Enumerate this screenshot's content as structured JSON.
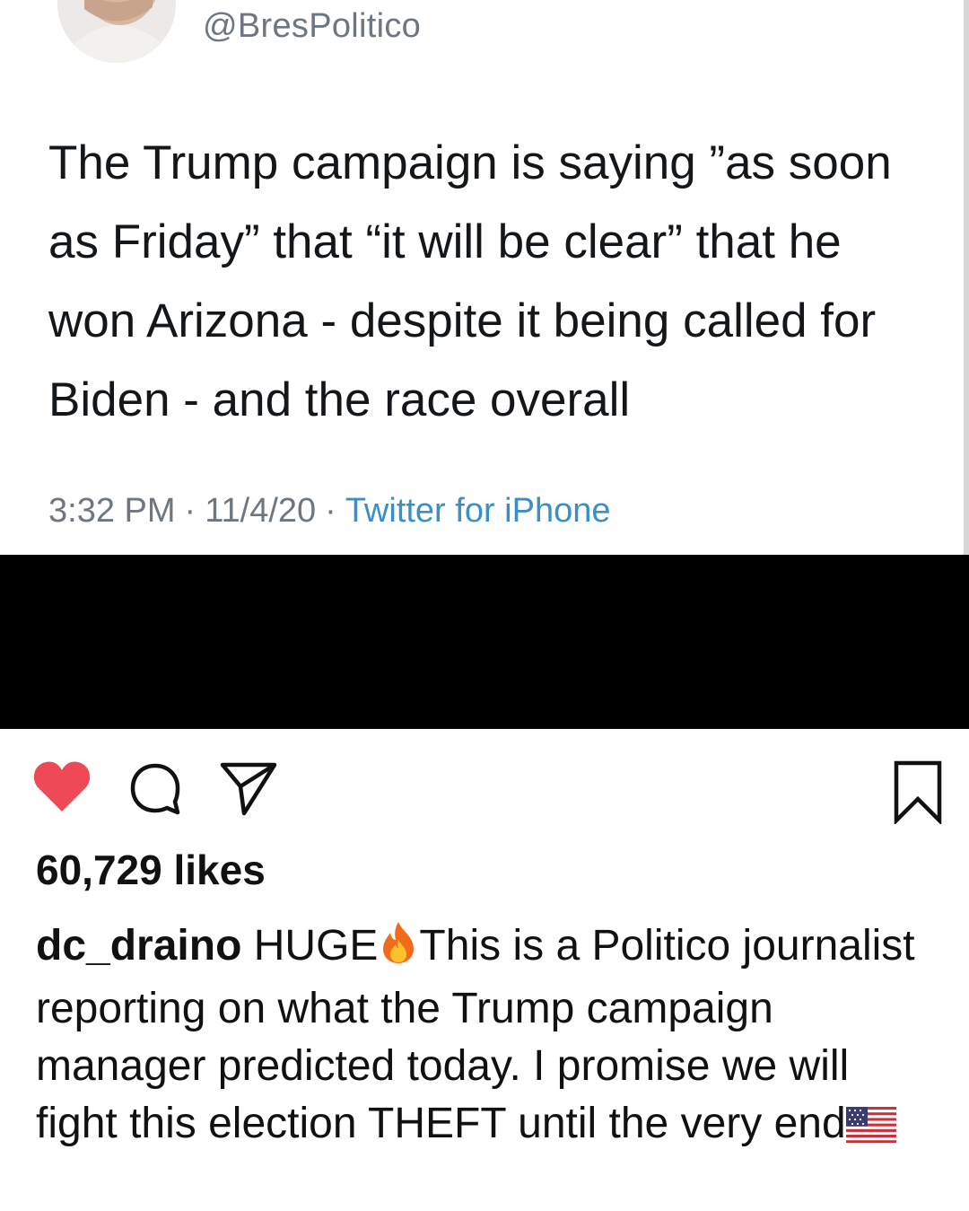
{
  "tweet": {
    "handle": "@BresPolitico",
    "text": "The Trump campaign is saying ”as soon as Friday” that “it will be clear” that he won Arizona - despite it being called for Biden - and the race overall",
    "time": "3:32 PM",
    "date": "11/4/20",
    "separator": "·",
    "source": "Twitter for iPhone"
  },
  "instagram": {
    "likes": "60,729 likes",
    "caption": {
      "username": "dc_draino",
      "part1": "HUGE",
      "emoji1": "fire-emoji",
      "part2": "This is a Politico journalist reporting on what the Trump campaign manager predicted today. I promise we will fight this election THEFT until the very end",
      "emoji2": "us-flag-emoji"
    },
    "icons": {
      "like": "heart-icon",
      "comment": "comment-icon",
      "share": "send-icon",
      "save": "bookmark-icon"
    }
  },
  "colors": {
    "heart": "#ed4956",
    "meta_gray": "#6e7780",
    "source_blue": "#3a8fc9",
    "band": "#000000"
  }
}
